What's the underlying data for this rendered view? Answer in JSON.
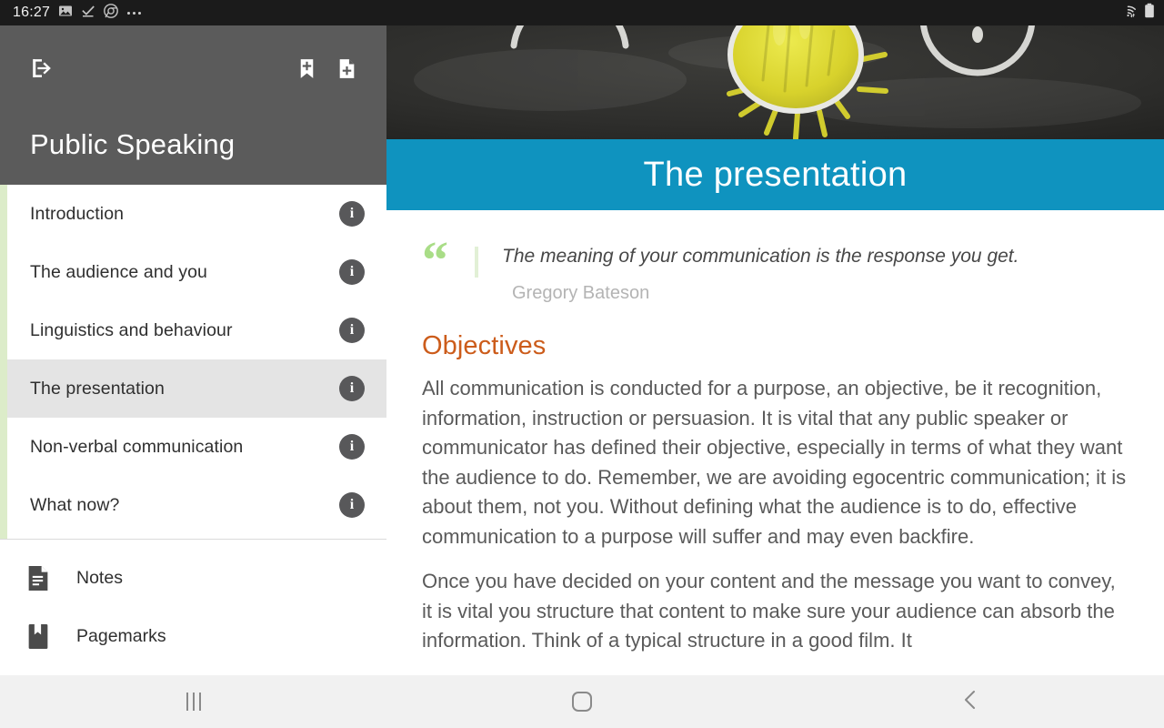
{
  "status_bar": {
    "time": "16:27",
    "left_icons": [
      "image-icon",
      "download-complete-icon",
      "chrome-icon",
      "more-notifications-icon"
    ],
    "right_icons": [
      "wifi-icon",
      "battery-icon"
    ]
  },
  "drawer": {
    "exit_icon": "exit-to-app-icon",
    "add_bookmark_icon": "add-bookmark-icon",
    "add_note_icon": "add-note-icon",
    "title": "Public Speaking",
    "toc": [
      {
        "label": "Introduction",
        "info": "i",
        "active": false
      },
      {
        "label": "The audience and you",
        "info": "i",
        "active": false
      },
      {
        "label": "Linguistics and behaviour",
        "info": "i",
        "active": false
      },
      {
        "label": "The presentation",
        "info": "i",
        "active": true
      },
      {
        "label": "Non-verbal communication",
        "info": "i",
        "active": false
      },
      {
        "label": "What now?",
        "info": "i",
        "active": false
      }
    ],
    "footer": [
      {
        "label": "Notes",
        "icon": "notes-document-icon"
      },
      {
        "label": "Pagemarks",
        "icon": "pagemark-bookmark-icon"
      }
    ]
  },
  "content": {
    "hero_alt": "chalkboard-sun-drawing",
    "chapter_title": "The presentation",
    "quote": {
      "mark": "“",
      "text": "The meaning of your communication is the response you get.",
      "author": "Gregory Bateson"
    },
    "section_title": "Objectives",
    "paragraphs": [
      "All communication is conducted for a purpose, an objective, be it recognition, information, instruction or persuasion. It is vital that any public speaker or communicator has defined their objective, especially in terms of what they want the audience to do. Remember, we are avoiding egocentric communication; it is about them, not you. Without defining what the audience is to do, effective communication to a purpose will suffer and may even backfire.",
      "Once you have decided on your content and the message you want to convey, it is vital you structure that content to make sure your audience can absorb the information. Think of a typical structure in a good film. It"
    ]
  },
  "nav_bar": {
    "recents_label": "recents-icon",
    "home_label": "home-icon",
    "back_label": "back-icon"
  },
  "colors": {
    "accent_blue": "#0f93bf",
    "accent_orange": "#cc5c1b",
    "accent_green": "#a9dd87",
    "rail_green": "#dcecc9",
    "drawer_header": "#5b5b5b",
    "selected_row": "#e4e4e4"
  }
}
